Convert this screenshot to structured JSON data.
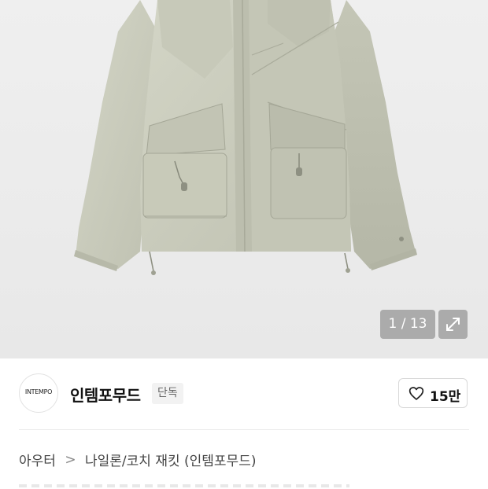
{
  "gallery": {
    "counter_text": "1 / 13",
    "expand_icon": "expand-icon",
    "image_subject": "jacket-product-photo",
    "current_index": 1,
    "total_images": 13
  },
  "brand": {
    "logo_text": "INTEMPO",
    "name": "인템포무드",
    "tag": "단독",
    "like_icon": "heart-icon",
    "like_count": "15만"
  },
  "breadcrumb": {
    "category": "아우터",
    "separator": ">",
    "item": "나일론/코치 재킷 (인템포무드)"
  },
  "colors": {
    "jacket": "#c9cbbb",
    "background": "#ececec",
    "overlay": "#7f7f7f"
  }
}
